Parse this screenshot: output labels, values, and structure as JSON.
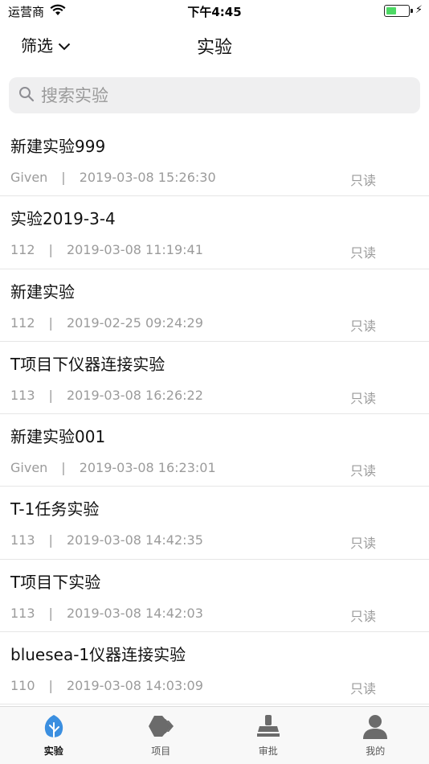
{
  "status_bar": {
    "carrier": "运营商",
    "time": "下午4:45",
    "battery_level": 0.4
  },
  "nav": {
    "filter_label": "筛选",
    "title": "实验"
  },
  "search": {
    "placeholder": "搜索实验"
  },
  "experiments": [
    {
      "title": "新建实验999",
      "owner": "Given",
      "sep": "|",
      "datetime": "2019-03-08 15:26:30",
      "status": "只读"
    },
    {
      "title": "实验2019-3-4",
      "owner": "112",
      "sep": "|",
      "datetime": "2019-03-08 11:19:41",
      "status": "只读"
    },
    {
      "title": "新建实验",
      "owner": "112",
      "sep": "|",
      "datetime": "2019-02-25 09:24:29",
      "status": "只读"
    },
    {
      "title": "T项目下仪器连接实验",
      "owner": "113",
      "sep": "|",
      "datetime": "2019-03-08 16:26:22",
      "status": "只读"
    },
    {
      "title": "新建实验001",
      "owner": "Given",
      "sep": "|",
      "datetime": "2019-03-08 16:23:01",
      "status": "只读"
    },
    {
      "title": "T-1任务实验",
      "owner": "113",
      "sep": "|",
      "datetime": "2019-03-08 14:42:35",
      "status": "只读"
    },
    {
      "title": "T项目下实验",
      "owner": "113",
      "sep": "|",
      "datetime": "2019-03-08 14:42:03",
      "status": "只读"
    },
    {
      "title": "bluesea-1仪器连接实验",
      "owner": "110",
      "sep": "|",
      "datetime": "2019-03-08 14:03:09",
      "status": "只读"
    }
  ],
  "tabs": [
    {
      "label": "实验",
      "icon": "leaf-icon",
      "active": true
    },
    {
      "label": "项目",
      "icon": "layers-icon",
      "active": false
    },
    {
      "label": "审批",
      "icon": "stamp-icon",
      "active": false
    },
    {
      "label": "我的",
      "icon": "user-icon",
      "active": false
    }
  ],
  "colors": {
    "accent": "#3b8fe0",
    "tab_inactive": "#6b6b6b",
    "meta_text": "#9b9b9b"
  }
}
